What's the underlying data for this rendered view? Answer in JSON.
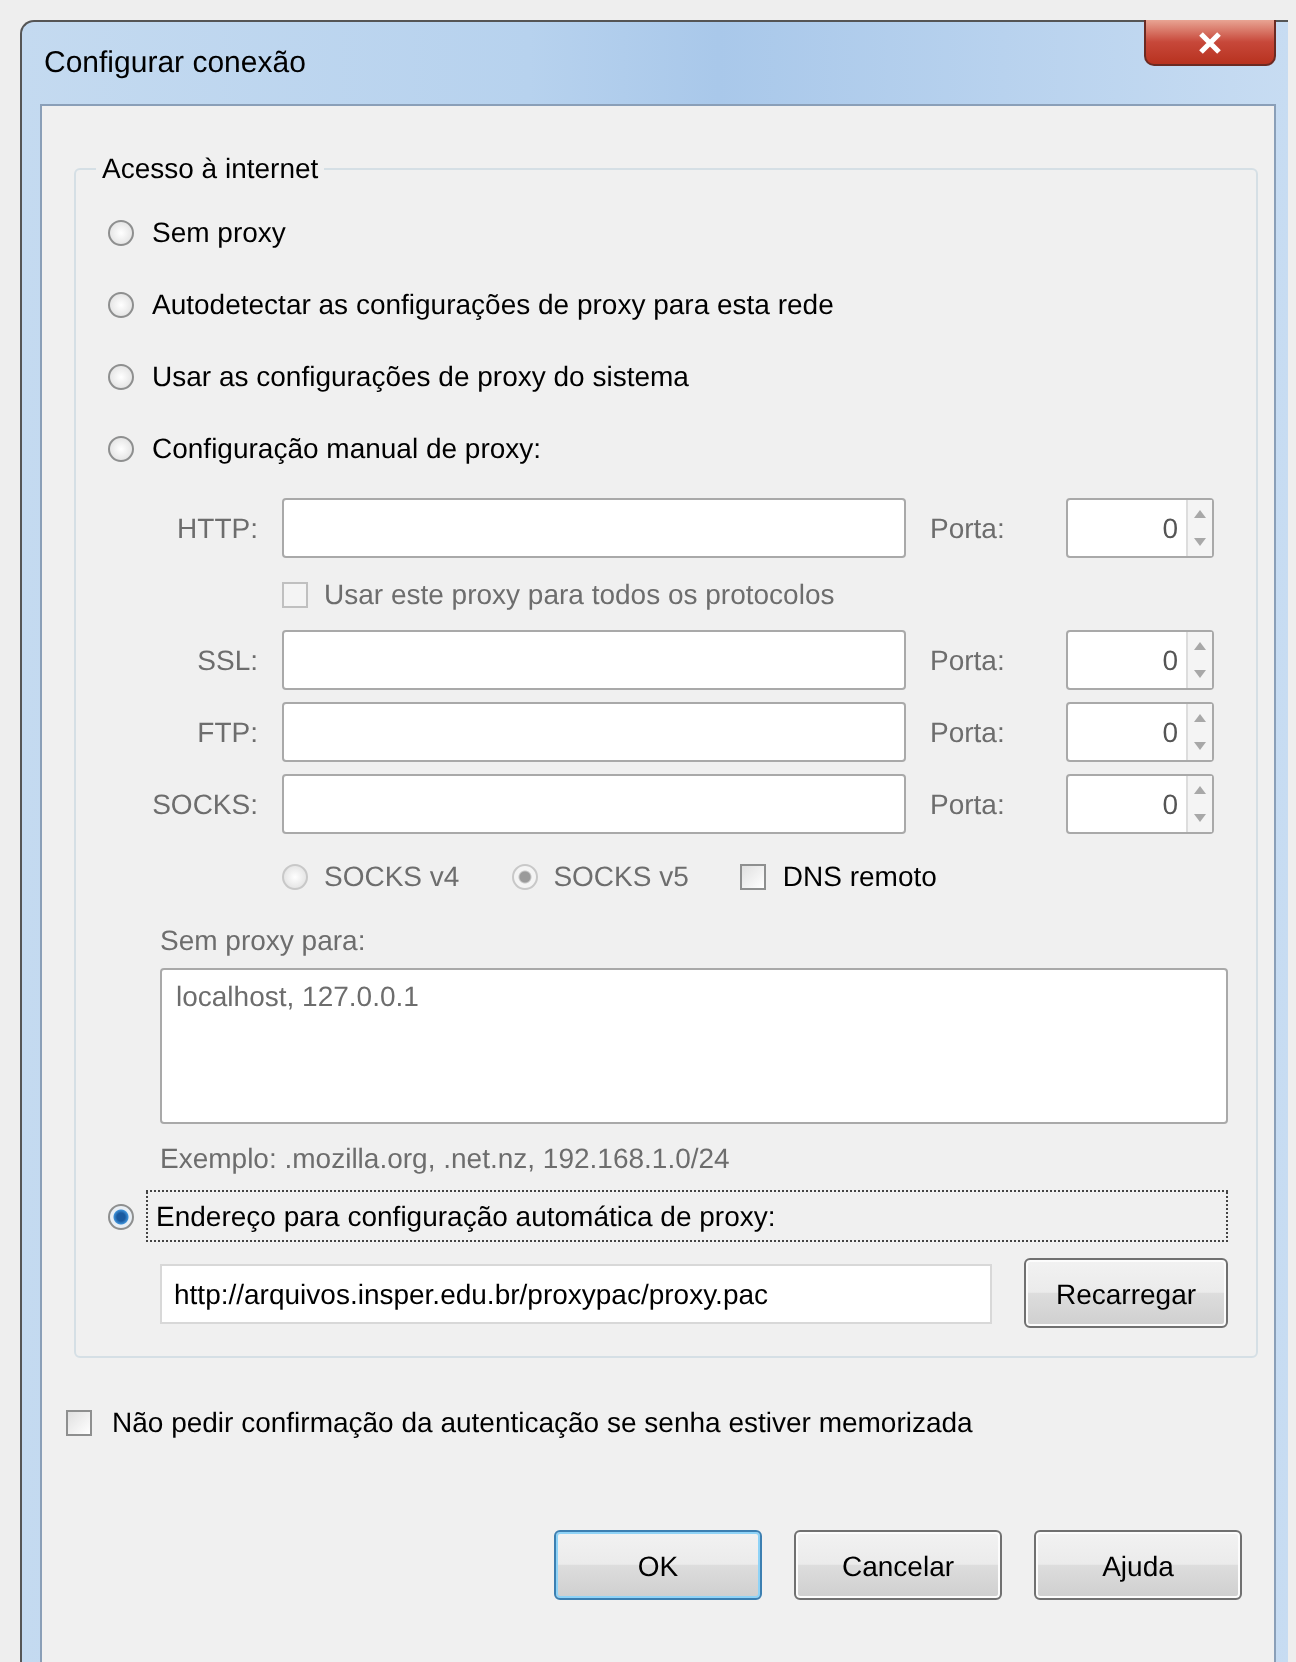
{
  "window": {
    "title": "Configurar conexão"
  },
  "group": {
    "legend": "Acesso à internet"
  },
  "proxy_modes": [
    {
      "label": "Sem proxy",
      "selected": false
    },
    {
      "label": "Autodetectar as configurações de proxy para esta rede",
      "selected": false
    },
    {
      "label": "Usar as configurações de proxy do sistema",
      "selected": false
    },
    {
      "label": "Configuração manual de proxy:",
      "selected": false
    }
  ],
  "manual": {
    "disabled": true,
    "http": {
      "label": "HTTP:",
      "port_label": "Porta:",
      "port": "0"
    },
    "share_all": {
      "label": "Usar este proxy para todos os protocolos",
      "checked": false
    },
    "proxies": [
      {
        "label": "SSL:",
        "port_label": "Porta:",
        "port": "0"
      },
      {
        "label": "FTP:",
        "port_label": "Porta:",
        "port": "0"
      },
      {
        "label": "SOCKS:",
        "port_label": "Porta:",
        "port": "0"
      }
    ],
    "socks_versions": [
      {
        "label": "SOCKS v4",
        "selected": false
      },
      {
        "label": "SOCKS v5",
        "selected": true
      }
    ],
    "remote_dns": {
      "label": "DNS remoto",
      "checked": false
    },
    "no_proxy_for": {
      "label": "Sem proxy para:",
      "value": "localhost, 127.0.0.1",
      "example": "Exemplo: .mozilla.org, .net.nz, 192.168.1.0/24"
    }
  },
  "auto_config": {
    "label": "Endereço para configuração automática de proxy:",
    "selected": true,
    "url": "http://arquivos.insper.edu.br/proxypac/proxy.pac",
    "reload_button": "Recarregar"
  },
  "confirm_auth": {
    "label": "Não pedir confirmação da autenticação se senha estiver memorizada",
    "checked": false
  },
  "buttons": [
    {
      "label": "OK",
      "focused": true
    },
    {
      "label": "Cancelar",
      "focused": false
    },
    {
      "label": "Ajuda",
      "focused": false
    }
  ]
}
